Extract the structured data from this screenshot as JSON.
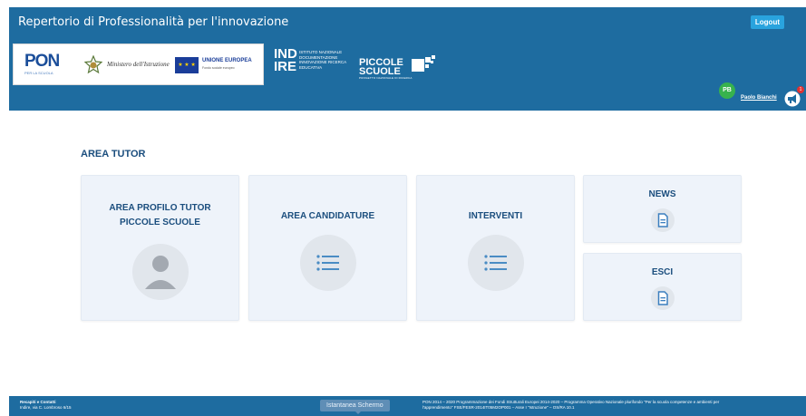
{
  "header": {
    "title": "Repertorio di Professionalità per l'innovazione",
    "logout_label": "Logout",
    "logos": {
      "pon": "PON",
      "pon_sub": "PER LA SCUOLA",
      "ministero": "Ministero dell'Istruzione",
      "eu": "UNIONE EUROPEA",
      "eu_sub": "Fondo sociale europeo",
      "indire_big_1": "IND",
      "indire_big_2": "IRE",
      "indire_small": "ISTITUTO NAZIONALE DOCUMENTAZIONE INNOVAZIONE RICERCA EDUCATIVA",
      "piccole_1": "PICCOLE",
      "piccole_2": "SCUOLE",
      "piccole_sub": "PROGETTO NAZIONALE DI RICERCA"
    },
    "user": {
      "initials": "PB",
      "name": "Paolo Bianchi",
      "notifications": "1"
    }
  },
  "main": {
    "section_title": "AREA TUTOR",
    "cards": {
      "profilo_line1": "AREA PROFILO TUTOR",
      "profilo_line2": "PICCOLE SCUOLE",
      "candidature": "AREA CANDIDATURE",
      "interventi": "INTERVENTI",
      "news": "NEWS",
      "esci": "ESCI"
    }
  },
  "footer": {
    "contacts_title": "Recapiti e Contatti",
    "contacts_address": "Indire, via C. Lombroso 6/15",
    "snapshot_label": "Istantanea Schermo",
    "program_line1": "PON 2014 – 2020 Programmazione dei Fondi Strutturali Europei 2014-2020 – Programma Operativo Nazionale plurifondo \"Per la scuola competenze e ambienti per",
    "program_line2": "l'apprendimento\" FSE/FESR-2014IT05M2OP001 – Asse I \"Istruzione\" – OS/RA 10.1"
  },
  "colors": {
    "header_bg": "#1e6ca0",
    "card_bg": "#eef3fa",
    "title_text": "#1b4e7e",
    "logout_bg": "#29a3de",
    "avatar_bg": "#37b24d",
    "badge_bg": "#e03131"
  },
  "icons": {
    "profilo": "user-avatar-icon",
    "candidature": "list-icon",
    "interventi": "list-icon",
    "news": "document-icon",
    "esci": "document-icon",
    "notifications": "megaphone-icon"
  }
}
